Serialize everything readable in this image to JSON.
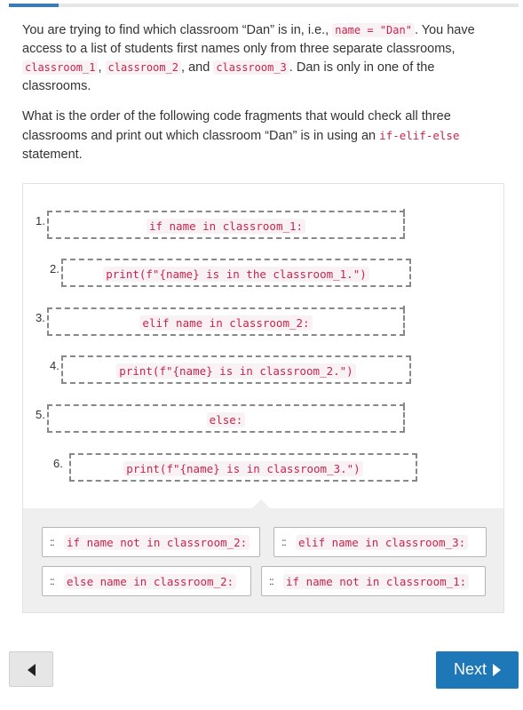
{
  "question": {
    "p1": {
      "t1": "You are trying to find which classroom “Dan” is in, i.e.,",
      "c1": "name = \"Dan\"",
      "t2": ". You have access to a list of students first names only from three separate classrooms,",
      "c2": "classroom_1",
      "t3": ",",
      "c3": "classroom_2",
      "t4": ", and",
      "c4": "classroom_3",
      "t5": ". Dan is only in one of the classrooms."
    },
    "p2": {
      "t1": "What is the order of the following code fragments that would check all three classrooms and print out which classroom “Dan” is in using an",
      "c1": "if-elif-else",
      "t2": "statement."
    }
  },
  "answer": [
    {
      "num": "1.",
      "code": "if name in classroom_1:"
    },
    {
      "num": "2.",
      "code": "print(f\"{name} is in the classroom_1.\")"
    },
    {
      "num": "3.",
      "code": "elif name in classroom_2:"
    },
    {
      "num": "4.",
      "code": "print(f\"{name} is in classroom_2.\")"
    },
    {
      "num": "5.",
      "code": "else:"
    },
    {
      "num": "6.",
      "code": "print(f\"{name} is in classroom_3.\")"
    }
  ],
  "bank": [
    {
      "code": "if name not in classroom_2:"
    },
    {
      "code": "elif name in classroom_3:"
    },
    {
      "code": "else name in classroom_2:"
    },
    {
      "code": "if name not in classroom_1:"
    }
  ],
  "nav": {
    "next_label": "Next"
  },
  "colors": {
    "code_text": "#c7254e",
    "code_bg": "#f9f2f4",
    "next_bg": "#1e78b7",
    "progress": "#3d7ab8"
  }
}
